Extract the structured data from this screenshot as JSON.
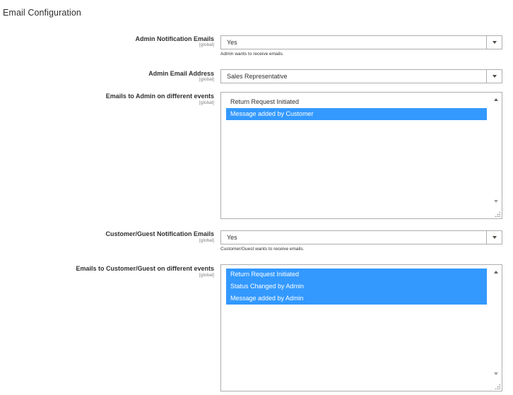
{
  "section": {
    "title": "Email Configuration"
  },
  "fields": {
    "admin_notification": {
      "label": "Admin Notification Emails",
      "scope": "[global]",
      "value": "Yes",
      "note": "Admin wants to receive emails."
    },
    "admin_email": {
      "label": "Admin Email Address",
      "scope": "[global]",
      "value": "Sales Representative"
    },
    "admin_events": {
      "label": "Emails to Admin on different events",
      "scope": "[global]",
      "options": [
        {
          "label": "Return Request Initiated",
          "selected": false
        },
        {
          "label": "Message added by Customer",
          "selected": true
        }
      ]
    },
    "customer_notification": {
      "label": "Customer/Guest Notification Emails",
      "scope": "[global]",
      "value": "Yes",
      "note": "Customer/Guest wants to receive emails."
    },
    "customer_events": {
      "label": "Emails to Customer/Guest on different events",
      "scope": "[global]",
      "options": [
        {
          "label": "Return Request Initiated",
          "selected": true
        },
        {
          "label": "Status Changed by Admin",
          "selected": true
        },
        {
          "label": "Message added by Admin",
          "selected": true
        }
      ]
    }
  },
  "colors": {
    "selection": "#3399ff",
    "border": "#adadad",
    "text": "#303030"
  },
  "icons": {
    "select_arrow": "chevron-down-icon",
    "scroll_up": "scroll-up-icon",
    "scroll_down": "scroll-down-icon",
    "resize": "resize-grip-icon"
  }
}
